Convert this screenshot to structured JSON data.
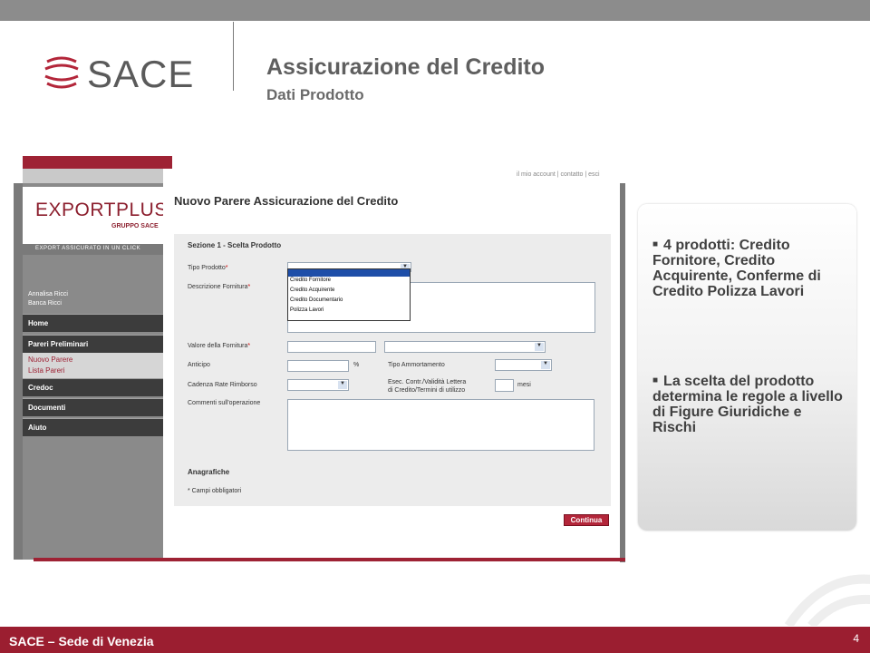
{
  "header": {
    "logo_text": "SACE",
    "title": "Assicurazione del Credito",
    "subtitle": "Dati Prodotto"
  },
  "screenshot": {
    "top_nav": "il mio account | contatto | esci",
    "logo_text": "EXPORTPLUS",
    "logo_sub": "GRUPPO SACE",
    "slogan": "EXPORT ASSICURATO IN UN CLICK",
    "user_line1": "Annalisa Ricci",
    "user_line2": "Banca Ricci",
    "nav": {
      "home": "Home",
      "pareri": "Pareri Preliminari",
      "nuovo_parere": "Nuovo Parere",
      "lista_pareri": "Lista Pareri",
      "credoc": "Credoc",
      "documenti": "Documenti",
      "aiuto": "Aiuto"
    },
    "page_title": "Nuovo Parere Assicurazione del Credito",
    "section_title": "Sezione 1 - Scelta Prodotto",
    "labels": {
      "tipo_prodotto": "Tipo Prodotto",
      "descrizione": "Descrizione Fornitura",
      "valore": "Valore della Fornitura",
      "anticipo": "Anticipo",
      "percent": "%",
      "tipo_ammortamento": "Tipo Ammortamento",
      "cadenza": "Cadenza Rate Rimborso",
      "esec_line1": "Esec. Contr./Validità Lettera",
      "esec_line2": "di Credito/Termini di utilizzo",
      "mesi": "mesi",
      "commenti": "Commenti sull'operazione",
      "req_mark": "*"
    },
    "dropdown_options": [
      "Credito Fornitore",
      "Credito Acquirente",
      "Credito Documentario",
      "Polizza Lavori"
    ],
    "anagrafiche": "Anagrafiche",
    "campi_obbligatori": "* Campi obbligatori",
    "continua_button": "Continua"
  },
  "panel": {
    "bullet1": "4 prodotti: Credito Fornitore, Credito Acquirente, Conferme di Credito Polizza Lavori",
    "bullet2": "La scelta del prodotto determina le regole a livello di Figure Giuridiche e Rischi"
  },
  "footer": {
    "text": "SACE – Sede di Venezia",
    "page_number": "4"
  },
  "colors": {
    "brand_red": "#9b1e30",
    "text_gray": "#5f5f5f"
  }
}
